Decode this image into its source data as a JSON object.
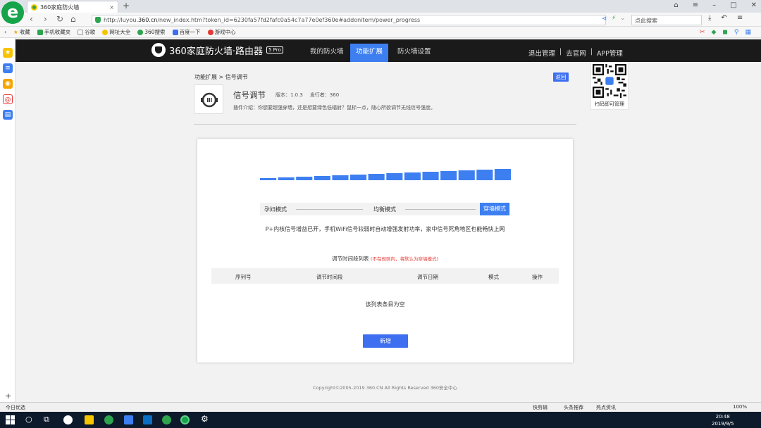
{
  "browser": {
    "tab_title": "360家庭防火墙",
    "url_prefix": "http://luyou.",
    "url_domain": "360.cn",
    "url_suffix": "/new_index.htm?token_id=6230fa57fd2fafc0a54c7a77e0ef360e#addonitem/power_progress",
    "search_placeholder": "点此搜索",
    "bookmarks": [
      "收藏",
      "手机收藏夹",
      "谷歌",
      "网址大全",
      "360搜索",
      "百度一下",
      "游戏中心"
    ]
  },
  "app": {
    "brand": "360家庭防火墙·路由器",
    "edition": "5 Pro",
    "nav": [
      "我的防火墙",
      "功能扩展",
      "防火墙设置"
    ],
    "right_links": [
      "退出管理",
      "|",
      "去官网",
      "|",
      "APP管理"
    ],
    "qr_label": "扫码即可管理"
  },
  "page": {
    "breadcrumb": "功能扩展 > 信号调节",
    "back_label": "返回",
    "plugin_name": "信号调节",
    "version_label": "版本：1.0.3",
    "publisher_label": "发行者：360",
    "description": "插件介绍：你想要超强穿墙，还是想要绿色低辐射？鼠标一点，随心所欲调节无线信号强度。"
  },
  "signal": {
    "levels": [
      1,
      2,
      3,
      4,
      5,
      6,
      7,
      8,
      9,
      10,
      11,
      12,
      13,
      14
    ],
    "mode_left": "孕妇模式",
    "mode_mid": "均衡模式",
    "mode_active": "穿墙模式",
    "mode_description": "P+内核信号增益已开，手机WiFi信号较弱时自动增强发射功率，家中信号死角地区也能畅快上网",
    "accent_color": "#3d7ff0"
  },
  "table": {
    "title": "调节时间段列表",
    "note": "(不在规则内，将默认为穿墙模式)",
    "columns": [
      "序列号",
      "调节时间段",
      "调节日期",
      "模式",
      "操作"
    ],
    "empty_text": "该列表条目为空",
    "add_button": "新增"
  },
  "footer": {
    "copyright": "Copyright©2005-2019 360.CN All Rights Reserved 360安全中心"
  },
  "status": {
    "left": "今日优选",
    "items": [
      "快剪辑",
      "头条推荐",
      "热点资讯"
    ],
    "zoom": "100%"
  },
  "taskbar": {
    "time": "20:48",
    "date": "2019/9/5"
  }
}
